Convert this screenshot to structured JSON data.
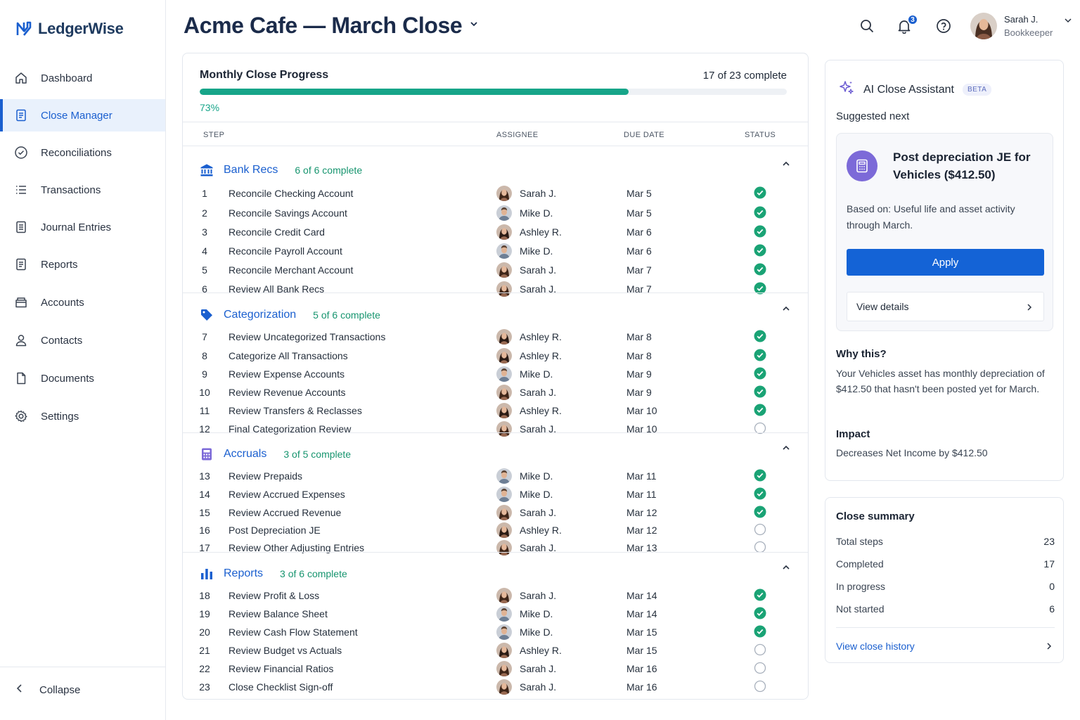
{
  "brand": {
    "name": "LedgerWise",
    "color": "#1a5fcf"
  },
  "sidebar": {
    "items": [
      {
        "label": "Dashboard",
        "icon": "home-icon"
      },
      {
        "label": "Close Manager",
        "icon": "checklist-icon",
        "active": true
      },
      {
        "label": "Reconciliations",
        "icon": "check-circle-icon"
      },
      {
        "label": "Transactions",
        "icon": "list-icon"
      },
      {
        "label": "Journal Entries",
        "icon": "journal-icon"
      },
      {
        "label": "Reports",
        "icon": "report-icon"
      },
      {
        "label": "Accounts",
        "icon": "folder-icon"
      },
      {
        "label": "Contacts",
        "icon": "person-icon"
      },
      {
        "label": "Documents",
        "icon": "document-icon"
      },
      {
        "label": "Settings",
        "icon": "gear-icon"
      }
    ],
    "collapse_label": "Collapse"
  },
  "header": {
    "title": "Acme Cafe — March Close",
    "notifications_count": "3",
    "user": {
      "name": "Sarah J.",
      "role": "Bookkeeper"
    }
  },
  "progress": {
    "title": "Monthly Close Progress",
    "count_text": "17 of 23 complete",
    "percent_text": "73%",
    "fraction": 0.73
  },
  "columns": {
    "step": "STEP",
    "assignee": "ASSIGNEE",
    "due": "DUE DATE",
    "status": "STATUS"
  },
  "groups": [
    {
      "name": "Bank Recs",
      "count": "6 of 6 complete",
      "icon": "bank-icon",
      "rows": [
        {
          "num": "1",
          "step": "Reconcile Checking Account",
          "assignee": "Sarah J.",
          "due": "Mar 5",
          "done": true
        },
        {
          "num": "2",
          "step": "Reconcile Savings Account",
          "assignee": "Mike D.",
          "due": "Mar 5",
          "done": true
        },
        {
          "num": "3",
          "step": "Reconcile Credit Card",
          "assignee": "Ashley R.",
          "due": "Mar 6",
          "done": true
        },
        {
          "num": "4",
          "step": "Reconcile Payroll Account",
          "assignee": "Mike D.",
          "due": "Mar 6",
          "done": true
        },
        {
          "num": "5",
          "step": "Reconcile Merchant Account",
          "assignee": "Sarah J.",
          "due": "Mar 7",
          "done": true
        },
        {
          "num": "6",
          "step": "Review All Bank Recs",
          "assignee": "Sarah J.",
          "due": "Mar 7",
          "done": true
        }
      ]
    },
    {
      "name": "Categorization",
      "count": "5 of 6 complete",
      "icon": "tag-icon",
      "rows": [
        {
          "num": "7",
          "step": "Review Uncategorized Transactions",
          "assignee": "Ashley R.",
          "due": "Mar 8",
          "done": true
        },
        {
          "num": "8",
          "step": "Categorize All Transactions",
          "assignee": "Ashley R.",
          "due": "Mar 8",
          "done": true
        },
        {
          "num": "9",
          "step": "Review Expense Accounts",
          "assignee": "Mike D.",
          "due": "Mar 9",
          "done": true
        },
        {
          "num": "10",
          "step": "Review Revenue Accounts",
          "assignee": "Sarah J.",
          "due": "Mar 9",
          "done": true
        },
        {
          "num": "11",
          "step": "Review Transfers & Reclasses",
          "assignee": "Ashley R.",
          "due": "Mar 10",
          "done": true
        },
        {
          "num": "12",
          "step": "Final Categorization Review",
          "assignee": "Sarah J.",
          "due": "Mar 10",
          "done": false
        }
      ]
    },
    {
      "name": "Accruals",
      "count": "3 of 5 complete",
      "icon": "calculator-icon",
      "rows": [
        {
          "num": "13",
          "step": "Review Prepaids",
          "assignee": "Mike D.",
          "due": "Mar 11",
          "done": true
        },
        {
          "num": "14",
          "step": "Review Accrued Expenses",
          "assignee": "Mike D.",
          "due": "Mar 11",
          "done": true
        },
        {
          "num": "15",
          "step": "Review Accrued Revenue",
          "assignee": "Sarah J.",
          "due": "Mar 12",
          "done": true
        },
        {
          "num": "16",
          "step": "Post Depreciation JE",
          "assignee": "Ashley R.",
          "due": "Mar 12",
          "done": false
        },
        {
          "num": "17",
          "step": "Review Other Adjusting Entries",
          "assignee": "Sarah J.",
          "due": "Mar 13",
          "done": false
        }
      ]
    },
    {
      "name": "Reports",
      "count": "3 of 6 complete",
      "icon": "bar-chart-icon",
      "rows": [
        {
          "num": "18",
          "step": "Review Profit & Loss",
          "assignee": "Sarah J.",
          "due": "Mar 14",
          "done": true
        },
        {
          "num": "19",
          "step": "Review Balance Sheet",
          "assignee": "Mike D.",
          "due": "Mar 14",
          "done": true
        },
        {
          "num": "20",
          "step": "Review Cash Flow Statement",
          "assignee": "Mike D.",
          "due": "Mar 15",
          "done": true
        },
        {
          "num": "21",
          "step": "Review Budget vs Actuals",
          "assignee": "Ashley R.",
          "due": "Mar 15",
          "done": false
        },
        {
          "num": "22",
          "step": "Review Financial Ratios",
          "assignee": "Sarah J.",
          "due": "Mar 16",
          "done": false
        },
        {
          "num": "23",
          "step": "Close Checklist Sign-off",
          "assignee": "Sarah J.",
          "due": "Mar 16",
          "done": false
        }
      ]
    }
  ],
  "assistant": {
    "title": "AI Close Assistant",
    "badge": "BETA",
    "suggested_label": "Suggested next",
    "suggestion_title": "Post depreciation JE for Vehicles ($412.50)",
    "suggestion_basis": "Based on: Useful life and asset activity through March.",
    "apply_label": "Apply",
    "details_label": "View details",
    "why_heading": "Why this?",
    "why_text": "Your Vehicles asset has monthly depreciation of $412.50 that hasn't been posted yet for March.",
    "impact_heading": "Impact",
    "impact_text": "Decreases Net Income by $412.50"
  },
  "summary": {
    "title": "Close summary",
    "rows": [
      {
        "label": "Total steps",
        "value": "23"
      },
      {
        "label": "Completed",
        "value": "17"
      },
      {
        "label": "In progress",
        "value": "0"
      },
      {
        "label": "Not started",
        "value": "6"
      }
    ],
    "history_label": "View close history"
  },
  "colors": {
    "accent": "#1a5fcf",
    "success": "#17a589",
    "assistant": "#7c6ad8"
  }
}
